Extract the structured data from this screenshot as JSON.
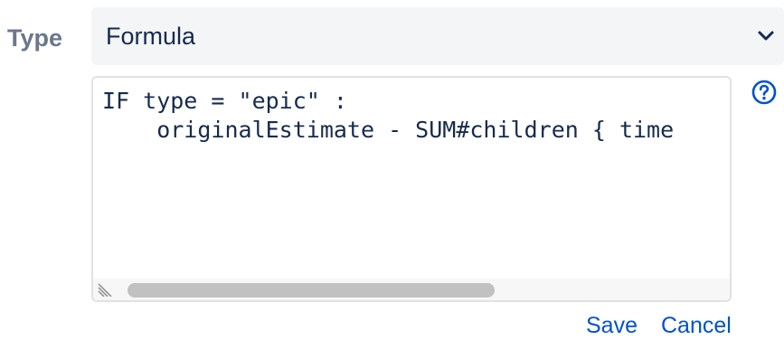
{
  "field": {
    "label": "Type",
    "selected_value": "Formula"
  },
  "editor": {
    "code_lines": [
      "IF type = \"epic\" :",
      "    originalEstimate - SUM#children { time"
    ]
  },
  "actions": {
    "save_label": "Save",
    "cancel_label": "Cancel"
  },
  "icons": {
    "dropdown": "chevron-down-icon",
    "help": "help-circle-icon",
    "resize": "resize-handle-icon"
  },
  "colors": {
    "label": "#6b778c",
    "select_bg": "#f4f5f7",
    "text": "#172b4d",
    "link": "#0052cc",
    "editor_border": "#dfe1e6",
    "scroll_thumb": "#c1c1c1"
  }
}
